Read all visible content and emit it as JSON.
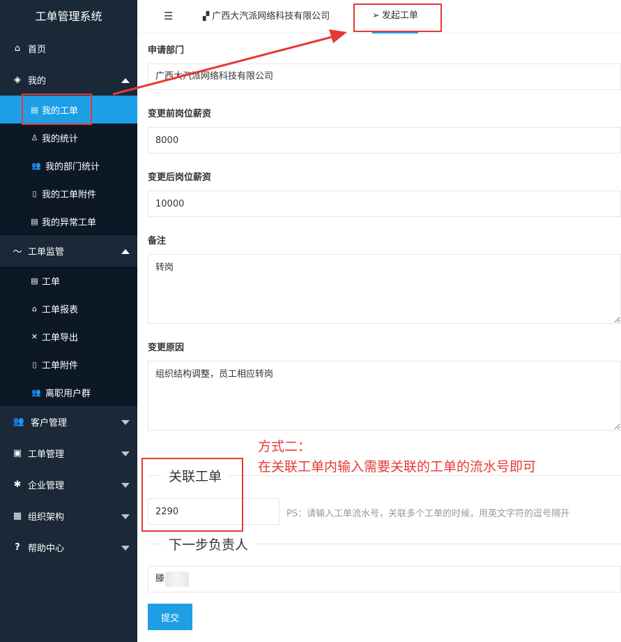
{
  "sidebar": {
    "title": "工单管理系统",
    "home": "首页",
    "mine": {
      "label": "我的",
      "items": [
        "我的工单",
        "我的统计",
        "我的部门统计",
        "我的工单附件",
        "我的异常工单"
      ]
    },
    "supervision": {
      "label": "工单监管",
      "items": [
        "工单",
        "工单报表",
        "工单导出",
        "工单附件",
        "离职用户群"
      ]
    },
    "customer": "客户管理",
    "ticket_mgmt": "工单管理",
    "enterprise": "企业管理",
    "org": "组织架构",
    "help": "帮助中心"
  },
  "tabs": {
    "company": "广西大汽派网络科技有限公司",
    "create": "发起工单"
  },
  "form": {
    "dept_label": "申请部门",
    "dept_value": "广西大汽派网络科技有限公司",
    "salary_before_label": "变更前岗位薪资",
    "salary_before_value": "8000",
    "salary_after_label": "变更后岗位薪资",
    "salary_after_value": "10000",
    "remark_label": "备注",
    "remark_value": "转岗",
    "reason_label": "变更原因",
    "reason_value": "组织结构调整，员工相应转岗",
    "related_legend": "关联工单",
    "related_value": "2290",
    "related_ps": "PS：请输入工单流水号，关联多个工单的时候，用英文字符的逗号隔开",
    "next_legend": "下一步负责人",
    "next_value": "滕",
    "submit": "提交"
  },
  "annotation": {
    "line1": "方式二：",
    "line2": "在关联工单内输入需要关联的工单的流水号即可"
  },
  "colors": {
    "sidebar_bg": "#1b2838",
    "active_bg": "#1e9fe5",
    "annotation": "#e53935"
  }
}
